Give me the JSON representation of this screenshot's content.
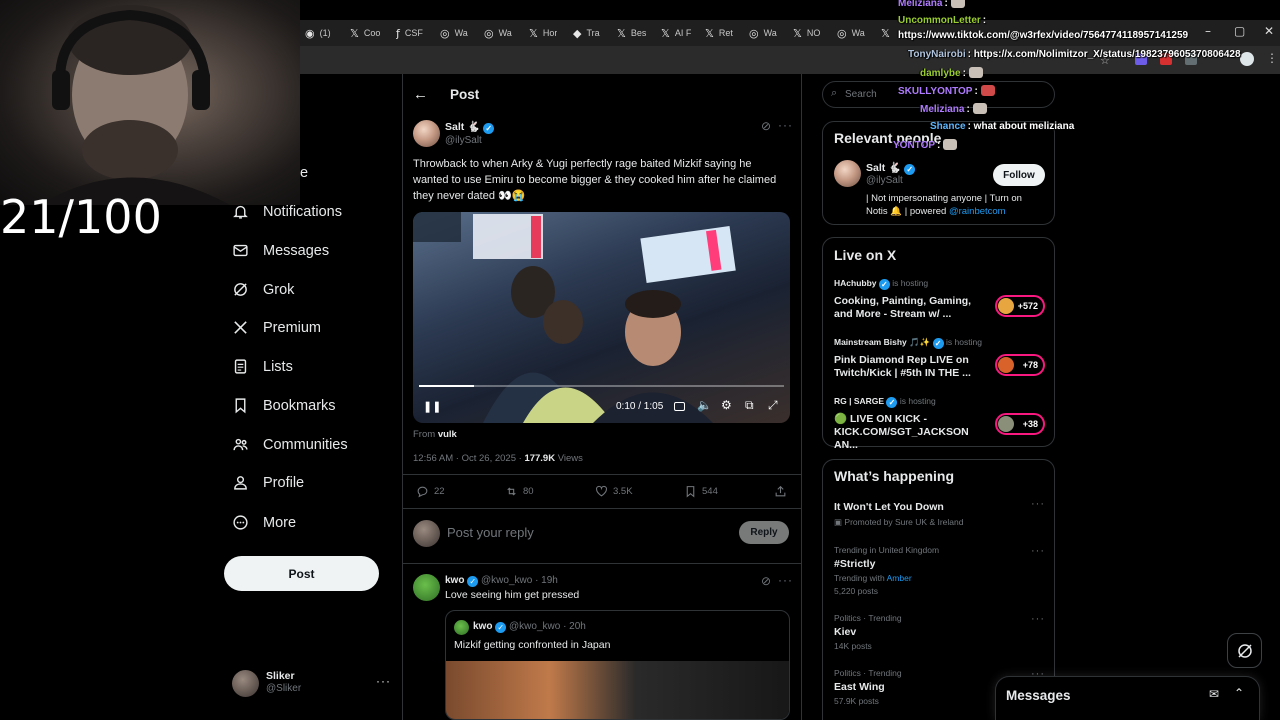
{
  "overlay": {
    "counter": "21/100",
    "chat": [
      {
        "user": "Meliziana",
        "color": "#b07cff",
        "text": ":"
      },
      {
        "user": "UncommonLetter",
        "color": "#9acd32",
        "text": ":"
      },
      {
        "user": "",
        "color": "#ffffff",
        "text": "https://www.tiktok.com/@w3rfex/video/7564774118957141259"
      },
      {
        "user": "TonyNairobi",
        "color": "#b0c4de",
        "text": ": https://x.com/Nolimitzor_X/status/1982379605370806428"
      },
      {
        "user": "damlybe",
        "color": "#9acd32",
        "text": ":"
      },
      {
        "user": "SKULLYONTOP",
        "color": "#b07cff",
        "text": ":"
      },
      {
        "user": "Meliziana",
        "color": "#b07cff",
        "text": ":"
      },
      {
        "user": "Shance",
        "color": "#5fb7ff",
        "text": ": what about meliziana"
      },
      {
        "user": "YONTOP",
        "color": "#b07cff",
        "text": ":"
      }
    ]
  },
  "browser": {
    "tabs": [
      {
        "icon": "instagram-icon",
        "glyph": "◉",
        "label": "(1)"
      },
      {
        "icon": "x-icon",
        "glyph": "𝕏",
        "label": "Coo"
      },
      {
        "icon": "csf-icon",
        "glyph": "ƒ",
        "label": "CSF"
      },
      {
        "icon": "twitch-icon",
        "glyph": "◎",
        "label": "Wa"
      },
      {
        "icon": "twitch-icon",
        "glyph": "◎",
        "label": "Wa"
      },
      {
        "icon": "x-icon",
        "glyph": "𝕏",
        "label": "Hor"
      },
      {
        "icon": "translate-icon",
        "glyph": "◆",
        "label": "Tra"
      },
      {
        "icon": "x-icon",
        "glyph": "𝕏",
        "label": "Bes"
      },
      {
        "icon": "x-icon",
        "glyph": "𝕏",
        "label": "AI F"
      },
      {
        "icon": "x-icon",
        "glyph": "𝕏",
        "label": "Ret"
      },
      {
        "icon": "twitch-icon",
        "glyph": "◎",
        "label": "Wa"
      },
      {
        "icon": "x-icon",
        "glyph": "𝕏",
        "label": "NO"
      },
      {
        "icon": "twitch-icon",
        "glyph": "◎",
        "label": "Wa"
      },
      {
        "icon": "x-icon",
        "glyph": "𝕏",
        "label": ""
      }
    ]
  },
  "nav": {
    "partial_label": "e",
    "items": [
      {
        "icon": "bell-icon",
        "label": "Notifications"
      },
      {
        "icon": "envelope-icon",
        "label": "Messages"
      },
      {
        "icon": "grok-icon",
        "label": "Grok"
      },
      {
        "icon": "x-logo-icon",
        "label": "Premium"
      },
      {
        "icon": "list-icon",
        "label": "Lists"
      },
      {
        "icon": "bookmark-icon",
        "label": "Bookmarks"
      },
      {
        "icon": "communities-icon",
        "label": "Communities"
      },
      {
        "icon": "person-icon",
        "label": "Profile"
      },
      {
        "icon": "more-circle-icon",
        "label": "More"
      }
    ],
    "post_button": "Post",
    "account": {
      "name": "Sliker",
      "handle": "@Sliker"
    }
  },
  "post": {
    "header_title": "Post",
    "author_name": "Salt",
    "author_handle": "@ilySalt",
    "text": "Throwback to when Arky & Yugi perfectly rage baited Mizkif saying he wanted to use Emiru to become bigger & they cooked him after he claimed they never dated 👀😭",
    "video_time": "0:10 / 1:05",
    "video_progress": 0.15,
    "from_label": "From",
    "from_user": "vulk",
    "timestamp": "12:56 AM · Oct 26, 2025 ·",
    "views_count": "177.9K",
    "views_label": "Views",
    "stats": {
      "replies": "22",
      "reposts": "80",
      "likes": "3.5K",
      "bookmarks": "544"
    },
    "reply_placeholder": "Post your reply",
    "reply_button": "Reply"
  },
  "reply": {
    "author_name": "kwo",
    "author_handle": "@kwo_kwo",
    "age": "· 19h",
    "text": "Love seeing him get pressed",
    "quote": {
      "author_name": "kwo",
      "author_handle": "@kwo_kwo",
      "age": "· 20h",
      "text": "Mizkif getting confronted in Japan"
    }
  },
  "sidebar": {
    "search_placeholder": "Search",
    "relevant": {
      "title": "Relevant people",
      "name": "Salt",
      "handle": "@ilySalt",
      "follow_label": "Follow",
      "bio": "| Not impersonating anyone | Turn on Notis 🔔 | powered",
      "bio_link": "@rainbetcom"
    },
    "live": {
      "title": "Live on X",
      "items": [
        {
          "host": "HAchubby",
          "hosting": "is hosting",
          "title": "Cooking, Painting, Gaming, and More - Stream w/ ...",
          "count": "+572"
        },
        {
          "host": "Mainstream Bishy 🎵✨",
          "hosting": "is hosting",
          "title": "Pink Diamond Rep LIVE on Twitch/Kick | #5th IN THE ...",
          "count": "+78"
        },
        {
          "host": "RG | SARGE",
          "hosting": "is hosting",
          "title": "🟢 LIVE ON KICK - KICK.COM/SGT_JACKSON AN...",
          "count": "+38"
        }
      ]
    },
    "happening": {
      "title": "What’s happening",
      "items": [
        {
          "meta": "",
          "name": "It Won't Let You Down",
          "sub": "Promoted by Sure UK & Ireland"
        },
        {
          "meta": "Trending in United Kingdom",
          "name": "#Strictly",
          "sub_prefix": "Trending with",
          "sub_link": "Amber",
          "posts": "5,220 posts"
        },
        {
          "meta": "Politics · Trending",
          "name": "Kiev",
          "posts": "14K posts"
        },
        {
          "meta": "Politics · Trending",
          "name": "East Wing",
          "posts": "57.9K posts"
        }
      ]
    },
    "messages_label": "Messages"
  }
}
